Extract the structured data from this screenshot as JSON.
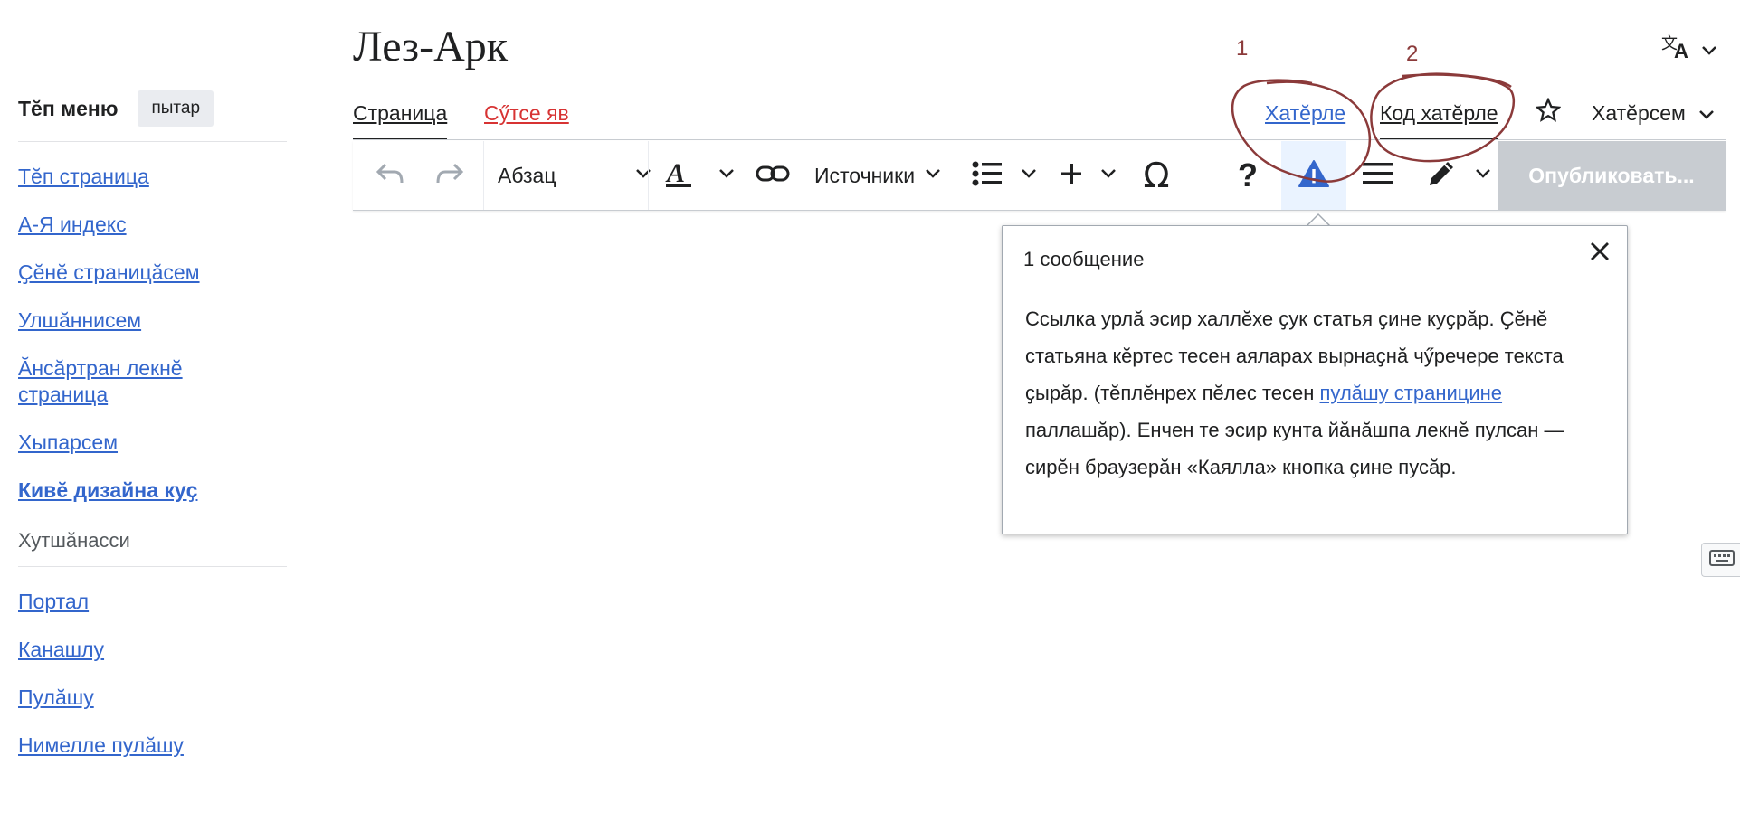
{
  "sidebar": {
    "title": "Тӗп меню",
    "hide_label": "пытар",
    "items": [
      {
        "label": "Тӗп страница"
      },
      {
        "label": "А-Я индекс"
      },
      {
        "label": "Ҫӗнӗ страницӑсем"
      },
      {
        "label": "Улшӑннисем"
      },
      {
        "label": "Ӑнсӑртран лекнӗ страница"
      },
      {
        "label": "Хыпарсем"
      },
      {
        "label": "Кивӗ дизайна куҫ"
      }
    ],
    "section_label": "Хутшӑнасси",
    "section_items": [
      {
        "label": "Портал"
      },
      {
        "label": "Канашлу"
      },
      {
        "label": "Пулӑшу"
      },
      {
        "label": "Нимелле пулӑшу"
      }
    ]
  },
  "page": {
    "title": "Лез-Арк"
  },
  "tabs": {
    "page": "Страница",
    "talk": "Сӳтсе яв",
    "edit": "Хатӗрле",
    "edit_source": "Код хатӗрле",
    "more": "Хатӗрсем"
  },
  "toolbar": {
    "paragraph": "Абзац",
    "sources": "Источники",
    "publish": "Опубликовать..."
  },
  "popup": {
    "title": "1 сообщение",
    "body_1": "Ссылка урлӑ эсир халлӗхе ҫук статья ҫине куҫрӑр. Ҫӗнӗ статьяна кӗртес тесен аяларах вырнаҫнӑ чӳречере текста ҫырӑр. (тӗплӗнрех пӗлес тесен ",
    "body_link": "пулӑшу страницине",
    "body_2": " паллашӑр). Енчен те эсир кунта йӑнӑшпа лекнӗ пулсан — сирӗн браузерӑн «Каялла» кнопка ҫине пусӑр."
  },
  "annotations": {
    "num_1": "1",
    "num_2": "2",
    "color": "#8b3a3a"
  },
  "colors": {
    "link": "#3366cc",
    "new_link": "#d73333",
    "publish_disabled": "#c8ccd1",
    "warning_icon": "#3366cc"
  }
}
